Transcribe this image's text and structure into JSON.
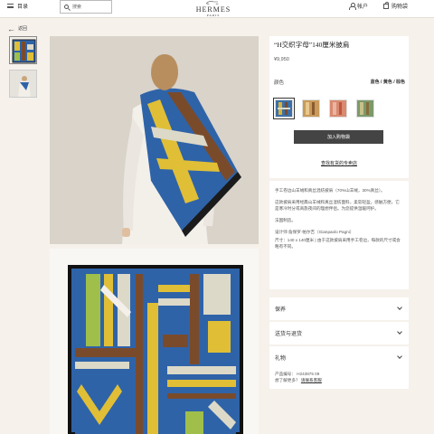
{
  "header": {
    "menu_label": "目录",
    "search_placeholder": "搜索",
    "logo_brand": "HERMES",
    "logo_city": "PARIS",
    "account_label": "帐户",
    "cart_label": "购物袋"
  },
  "back_label": "返回",
  "product": {
    "title": "“H交织字母”140厘米披肩",
    "price": "¥9,950",
    "color_label": "颜色",
    "color_value": "蓝色 / 黄色 / 棕色",
    "swatches": [
      {
        "name": "blue-yellow-brown",
        "color": "#3d6fa6",
        "accent": "#d8b339"
      },
      {
        "name": "tan",
        "color": "#c99a5a",
        "accent": "#e7c98e"
      },
      {
        "name": "pink-orange",
        "color": "#d98a6f",
        "accent": "#e8b6a1"
      },
      {
        "name": "green",
        "color": "#7a9a6a",
        "accent": "#c9c08a"
      }
    ],
    "add_to_bag": "加入购物袋",
    "store_link": "查找有货的专卖店"
  },
  "description": {
    "p1": "手工卷边山羊绒和真丝混纺披肩（70%山羊绒，30%真丝）。",
    "p2": "这款披肩采用经典山羊绒和真丝混纺面料，柔软轻盈，感触方便。它是寒冷时分或商旅夜间的理想伴侣。为您提供温暖呵护。",
    "p3": "法国制造。",
    "p4": "设计师 詹保罗·帕尔吉（Gianpaolo Pagni）",
    "p5": "尺寸：140 x 140厘米 | 由于这款披肩采用手工卷边，每款的尺寸或会略有不同。"
  },
  "accordions": {
    "care": "保养",
    "delivery": "送货与退货",
    "gift": "礼物"
  },
  "info": {
    "product_number": "产品编号：  H243875 09",
    "question": "想了解更多？",
    "contact": "请联系客服"
  },
  "colors": {
    "header_bg": "#ffffff",
    "page_bg": "#f6f1eb",
    "button_bg": "#444444",
    "scarf_blue": "#2f63a8",
    "scarf_yellow": "#e0bf36",
    "scarf_brown": "#7a4b2b"
  }
}
